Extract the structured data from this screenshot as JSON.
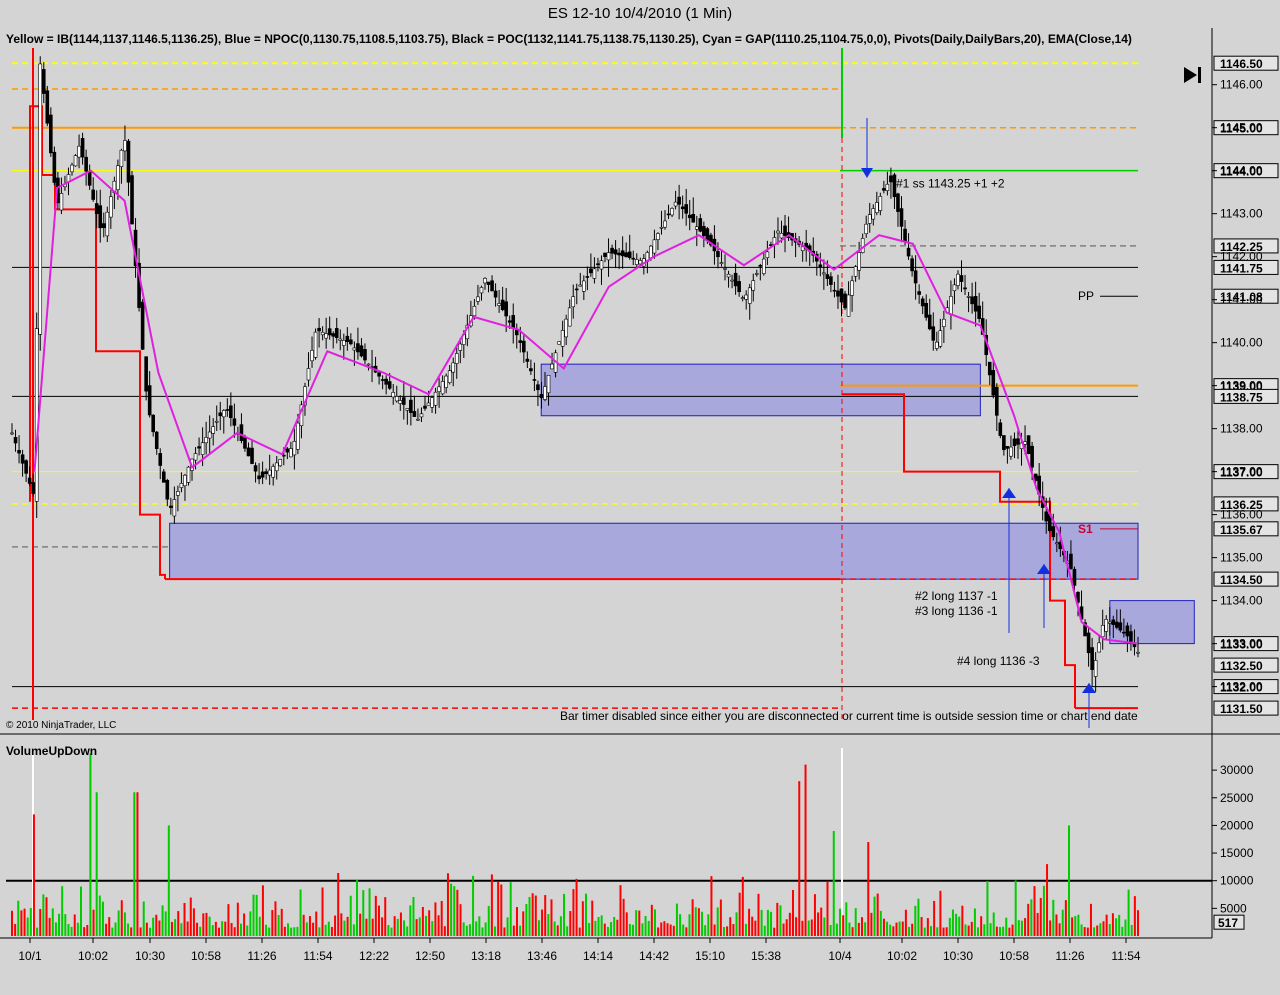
{
  "window": {
    "title": "ES 12-10  10/4/2010 (1 Min)"
  },
  "indicator_header": "Yellow = IB(1144,1137,1146.5,1136.25), Blue = NPOC(0,1130.75,1108.5,1103.75), Black = POC(1132,1141.75,1138.75,1130.25), Cyan = GAP(1110.25,1104.75,0,0), Pivots(Daily,DailyBars,20), EMA(Close,14)",
  "copyright": "© 2010 NinjaTrader, LLC",
  "bar_timer_message": "Bar timer disabled since either you are disconnected or current time is outside session time or chart end date",
  "volume_panel_title": "VolumeUpDown",
  "colors": {
    "background": "#d4d4d4",
    "ib_yellow": "#ffff00",
    "orange": "#ff9900",
    "red": "#ff0000",
    "ema_magenta": "#e020e0",
    "zone_blue": "#9a9ae0",
    "green": "#00cc00",
    "arrow_blue": "#1030e0",
    "s1_red": "#cc0033"
  },
  "chart_data": [
    {
      "type": "candlestick",
      "title": "ES 12-10  10/4/2010 (1 Min)",
      "ylim": [
        1131.2,
        1146.9
      ],
      "x_ticks": [
        "10/1",
        "10:02",
        "10:30",
        "10:58",
        "11:26",
        "11:54",
        "12:22",
        "12:50",
        "13:18",
        "13:46",
        "14:14",
        "14:42",
        "15:10",
        "15:38",
        "10/4",
        "10:02",
        "10:30",
        "10:58",
        "11:26",
        "11:54"
      ],
      "y_ticks": [
        "1146.00",
        "1145.00",
        "1144.00",
        "1143.00",
        "1142.00",
        "1141.00",
        "1140.00",
        "1139.00",
        "1138.00",
        "1137.00",
        "1136.00",
        "1135.00",
        "1134.00",
        "1133.00",
        "1132.00"
      ],
      "y_tick_values": [
        1146,
        1145,
        1144,
        1143,
        1142,
        1141,
        1140,
        1139,
        1138,
        1137,
        1136,
        1135,
        1134,
        1133,
        1132
      ],
      "price_markers": [
        {
          "label": "1146.50",
          "value": 1146.5
        },
        {
          "label": "1145.00",
          "value": 1145.0
        },
        {
          "label": "1144.00",
          "value": 1144.0
        },
        {
          "label": "1142.25",
          "value": 1142.25
        },
        {
          "label": "1141.75",
          "value": 1141.75
        },
        {
          "label": "1141.08",
          "value": 1141.08
        },
        {
          "label": "1139.00",
          "value": 1139.0
        },
        {
          "label": "1138.75",
          "value": 1138.75
        },
        {
          "label": "1137.00",
          "value": 1137.0
        },
        {
          "label": "1136.25",
          "value": 1136.25
        },
        {
          "label": "1135.67",
          "value": 1135.67
        },
        {
          "label": "1134.50",
          "value": 1134.5
        },
        {
          "label": "1133.00",
          "value": 1133.0
        },
        {
          "label": "1132.50",
          "value": 1132.5
        },
        {
          "label": "1132.00",
          "value": 1132.0
        },
        {
          "label": "1131.50",
          "value": 1131.5
        }
      ],
      "pivots": [
        {
          "label": "PP",
          "value": 1141.08
        },
        {
          "label": "S1",
          "value": 1135.67
        }
      ],
      "annotations": [
        {
          "text": "#1 ss 1143.25 +1 +2"
        },
        {
          "text": "#2 long 1137 -1"
        },
        {
          "text": "#3 long 1136 -1"
        },
        {
          "text": "#4 long 1136 -3"
        }
      ],
      "price_path": [
        [
          0,
          1137.9
        ],
        [
          0.02,
          1136.4
        ],
        [
          0.025,
          1146.5
        ],
        [
          0.04,
          1143.2
        ],
        [
          0.06,
          1144.6
        ],
        [
          0.08,
          1142.5
        ],
        [
          0.1,
          1144.8
        ],
        [
          0.12,
          1138.6
        ],
        [
          0.14,
          1136.1
        ],
        [
          0.16,
          1137.3
        ],
        [
          0.19,
          1138.5
        ],
        [
          0.22,
          1136.8
        ],
        [
          0.25,
          1137.6
        ],
        [
          0.27,
          1140.3
        ],
        [
          0.3,
          1140.0
        ],
        [
          0.33,
          1139.1
        ],
        [
          0.36,
          1138.2
        ],
        [
          0.39,
          1139.4
        ],
        [
          0.42,
          1141.5
        ],
        [
          0.45,
          1140.1
        ],
        [
          0.47,
          1138.7
        ],
        [
          0.5,
          1141.2
        ],
        [
          0.53,
          1142.1
        ],
        [
          0.56,
          1141.9
        ],
        [
          0.59,
          1143.3
        ],
        [
          0.62,
          1142.3
        ],
        [
          0.65,
          1141.0
        ],
        [
          0.68,
          1142.6
        ],
        [
          0.71,
          1142.1
        ],
        [
          0.74,
          1140.8
        ],
        [
          0.76,
          1142.9
        ],
        [
          0.78,
          1143.8
        ],
        [
          0.8,
          1141.6
        ],
        [
          0.82,
          1139.9
        ],
        [
          0.84,
          1141.6
        ],
        [
          0.86,
          1140.5
        ],
        [
          0.88,
          1137.5
        ],
        [
          0.9,
          1137.7
        ],
        [
          0.92,
          1135.7
        ],
        [
          0.94,
          1134.8
        ],
        [
          0.96,
          1132.3
        ],
        [
          0.97,
          1133.6
        ],
        [
          0.99,
          1133.2
        ],
        [
          1.0,
          1132.8
        ]
      ],
      "ema_path": [
        [
          0.02,
          1137.0
        ],
        [
          0.04,
          1143.6
        ],
        [
          0.07,
          1144.0
        ],
        [
          0.1,
          1143.3
        ],
        [
          0.13,
          1139.3
        ],
        [
          0.16,
          1137.1
        ],
        [
          0.2,
          1137.9
        ],
        [
          0.24,
          1137.4
        ],
        [
          0.28,
          1139.8
        ],
        [
          0.33,
          1139.3
        ],
        [
          0.37,
          1138.8
        ],
        [
          0.41,
          1140.6
        ],
        [
          0.45,
          1140.3
        ],
        [
          0.49,
          1139.4
        ],
        [
          0.53,
          1141.3
        ],
        [
          0.57,
          1142.0
        ],
        [
          0.61,
          1142.5
        ],
        [
          0.65,
          1141.8
        ],
        [
          0.69,
          1142.5
        ],
        [
          0.73,
          1141.7
        ],
        [
          0.77,
          1142.5
        ],
        [
          0.8,
          1142.3
        ],
        [
          0.83,
          1140.7
        ],
        [
          0.86,
          1140.4
        ],
        [
          0.89,
          1138.3
        ],
        [
          0.91,
          1136.6
        ],
        [
          0.93,
          1135.6
        ],
        [
          0.95,
          1133.5
        ],
        [
          0.97,
          1133.1
        ],
        [
          1.0,
          1133.0
        ]
      ],
      "zones": [
        {
          "name": "ib-zone",
          "y0": 1134.5,
          "y1": 1135.8,
          "x0": 0.14,
          "x1": 1.0
        },
        {
          "name": "midday-zone",
          "y0": 1138.3,
          "y1": 1139.5,
          "x0": 0.47,
          "x1": 0.86
        },
        {
          "name": "late-zone",
          "y0": 1133.0,
          "y1": 1134.0,
          "x0": 0.975,
          "x1": 1.05
        }
      ]
    },
    {
      "type": "bar",
      "title": "VolumeUpDown",
      "ylim": [
        0,
        34000
      ],
      "y_ticks": [
        "30000",
        "25000",
        "20000",
        "15000",
        "10000",
        "5000"
      ],
      "y_tick_values": [
        30000,
        25000,
        20000,
        15000,
        10000,
        5000
      ],
      "reference_level": 10000,
      "current_value": "517",
      "volume_spikes": [
        {
          "x": 0.02,
          "value": 22000,
          "dir": "up"
        },
        {
          "x": 0.07,
          "value": 33000,
          "dir": "up"
        },
        {
          "x": 0.075,
          "value": 26000,
          "dir": "up"
        },
        {
          "x": 0.11,
          "value": 26000,
          "dir": "down"
        },
        {
          "x": 0.14,
          "value": 20000,
          "dir": "down"
        },
        {
          "x": 0.7,
          "value": 28000,
          "dir": "down"
        },
        {
          "x": 0.705,
          "value": 31000,
          "dir": "down"
        },
        {
          "x": 0.73,
          "value": 19000,
          "dir": "up"
        },
        {
          "x": 0.76,
          "value": 17000,
          "dir": "up"
        },
        {
          "x": 0.92,
          "value": 13000,
          "dir": "down"
        },
        {
          "x": 0.94,
          "value": 20000,
          "dir": "down"
        }
      ]
    }
  ]
}
